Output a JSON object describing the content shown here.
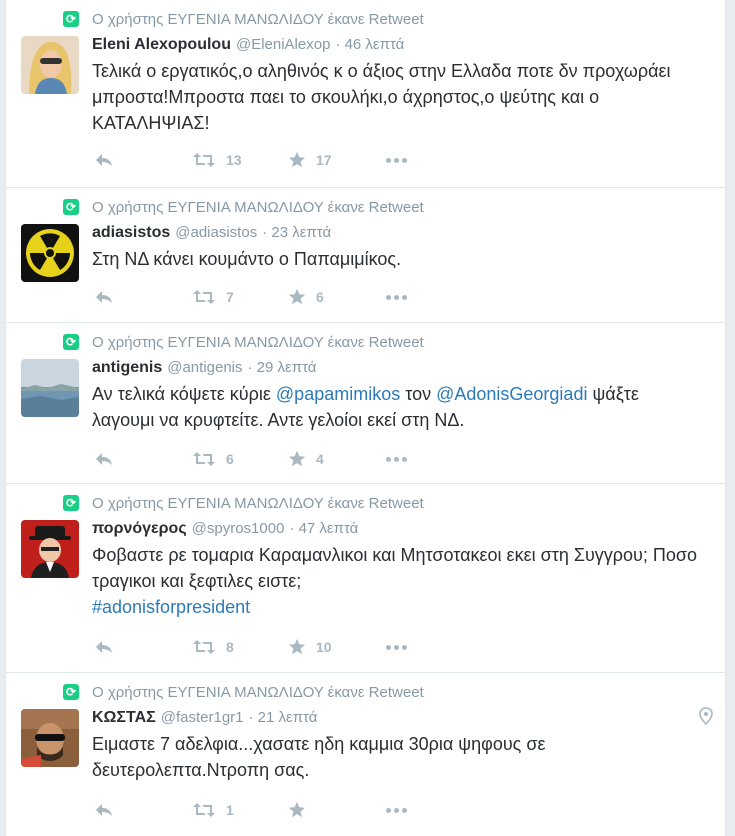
{
  "tweets": [
    {
      "context": "Ο χρήστης ΕΥΓΕΝΙΑ ΜΑΝΩΛΙΔΟΥ έκανε Retweet",
      "name": "Eleni Alexopoulou",
      "handle": "@EleniAlexop",
      "time": "· 46 λεπτά",
      "text_parts": [
        "Τελικά ο εργατικός,ο αληθινός κ ο άξιος στην Ελλαδα ποτε δν προχωράει μπροστα!Μπροστα παει το σκουλήκι,ο άχρηστος,ο ψεύτης και ο ΚΑΤΑΛΗΨΙΑΣ!"
      ],
      "retweets": "13",
      "likes": "17",
      "avatar": "blonde-woman-avatar"
    },
    {
      "context": "Ο χρήστης ΕΥΓΕΝΙΑ ΜΑΝΩΛΙΔΟΥ έκανε Retweet",
      "name": "adiasistos",
      "handle": "@adiasistos",
      "time": "· 23 λεπτά",
      "text_parts": [
        "Στη ΝΔ κάνει κουμάντο ο Παπαμιμίκος."
      ],
      "retweets": "7",
      "likes": "6",
      "avatar": "radiation-symbol-avatar"
    },
    {
      "context": "Ο χρήστης ΕΥΓΕΝΙΑ ΜΑΝΩΛΙΔΟΥ έκανε Retweet",
      "name": "antigenis",
      "handle": "@antigenis",
      "time": "· 29 λεπτά",
      "text_a": "Αν τελικά κόψετε κύριε ",
      "link_a": "@papamimikos",
      "text_b": " τον ",
      "link_b": "@AdonisGeorgiadi",
      "text_c": " ψάξτε λαγουμι να κρυφτείτε. Αντε γελοίοι εκεί στη ΝΔ.",
      "retweets": "6",
      "likes": "4",
      "avatar": "seascape-avatar"
    },
    {
      "context": "Ο χρήστης ΕΥΓΕΝΙΑ ΜΑΝΩΛΙΔΟΥ έκανε Retweet",
      "name": "πορνόγερος",
      "handle": "@spyros1000",
      "time": "· 47 λεπτά",
      "text_a": "Φοβαστε ρε τομαρια Καραμανλικοι και Μητσοτακεοι εκει στη Συγγρου; Ποσο τραγικοι και ξεφτιλες ειστε;",
      "hashtag": "#adonisforpresident",
      "retweets": "8",
      "likes": "10",
      "avatar": "man-in-hat-avatar"
    },
    {
      "context": "Ο χρήστης ΕΥΓΕΝΙΑ ΜΑΝΩΛΙΔΟΥ έκανε Retweet",
      "name": "ΚΩΣΤΑΣ",
      "handle": "@faster1gr1",
      "time": "· 21 λεπτά",
      "text_a": "Ειμαστε 7 αδελφια...χασατε ηδη καμμια 30ρια ψηφους σε δευτερολεπτα.Ντροπη σας.",
      "retweets": "1",
      "likes": "",
      "avatar": "man-sunglasses-avatar"
    }
  ],
  "icons": {
    "reply": "reply-icon",
    "retweet": "retweet-icon",
    "like": "star-icon",
    "more": "more-dots-icon",
    "location": "location-pin-icon"
  },
  "colors": {
    "retweet_badge": "#19cf86",
    "link": "#2b7bb9",
    "muted": "#8899a6",
    "action": "#aab8c2"
  }
}
